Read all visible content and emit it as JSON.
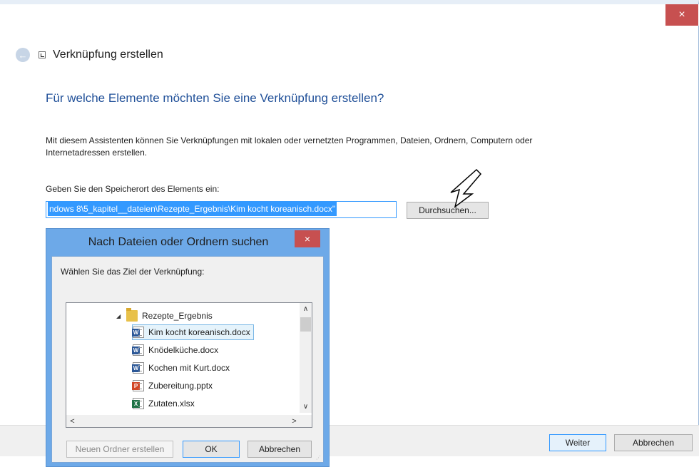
{
  "wizard": {
    "title": "Verknüpfung erstellen",
    "close_glyph": "×",
    "back_glyph": "←",
    "heading": "Für welche Elemente möchten Sie eine Verknüpfung erstellen?",
    "description": "Mit diesem Assistenten können Sie Verknüpfungen mit lokalen oder vernetzten Programmen, Dateien, Ordnern, Computern oder Internetadressen erstellen.",
    "path_label": "Geben Sie den Speicherort des Elements ein:",
    "path_value": "ndows 8\\5_kapitel__dateien\\Rezepte_Ergebnis\\Kim kocht koreanisch.docx\"",
    "browse_label": "Durchsuchen...",
    "next_label": "Weiter",
    "cancel_label": "Abbrechen"
  },
  "browse_dialog": {
    "title": "Nach Dateien oder Ordnern suchen",
    "close_glyph": "×",
    "prompt": "Wählen Sie das Ziel der Verknüpfung:",
    "tree": {
      "folder": {
        "label": "Rezepte_Ergebnis",
        "expander": "◢"
      },
      "files": [
        {
          "label": "Kim kocht koreanisch.docx",
          "kind": "word",
          "badge": "W",
          "selected": true
        },
        {
          "label": "Knödelküche.docx",
          "kind": "word",
          "badge": "W",
          "selected": false
        },
        {
          "label": "Kochen mit Kurt.docx",
          "kind": "word",
          "badge": "W",
          "selected": false
        },
        {
          "label": "Zubereitung.pptx",
          "kind": "ppt",
          "badge": "P",
          "selected": false
        },
        {
          "label": "Zutaten.xlsx",
          "kind": "xls",
          "badge": "X",
          "selected": false
        }
      ]
    },
    "scroll_glyphs": {
      "up": "∧",
      "down": "∨",
      "left": "<",
      "right": ">"
    },
    "new_folder_label": "Neuen Ordner erstellen",
    "ok_label": "OK",
    "cancel_label": "Abbrechen"
  },
  "colors": {
    "heading": "#1f4f98",
    "selection": "#3399ff",
    "close": "#c75050",
    "dialog_frame": "#6da9e8"
  }
}
